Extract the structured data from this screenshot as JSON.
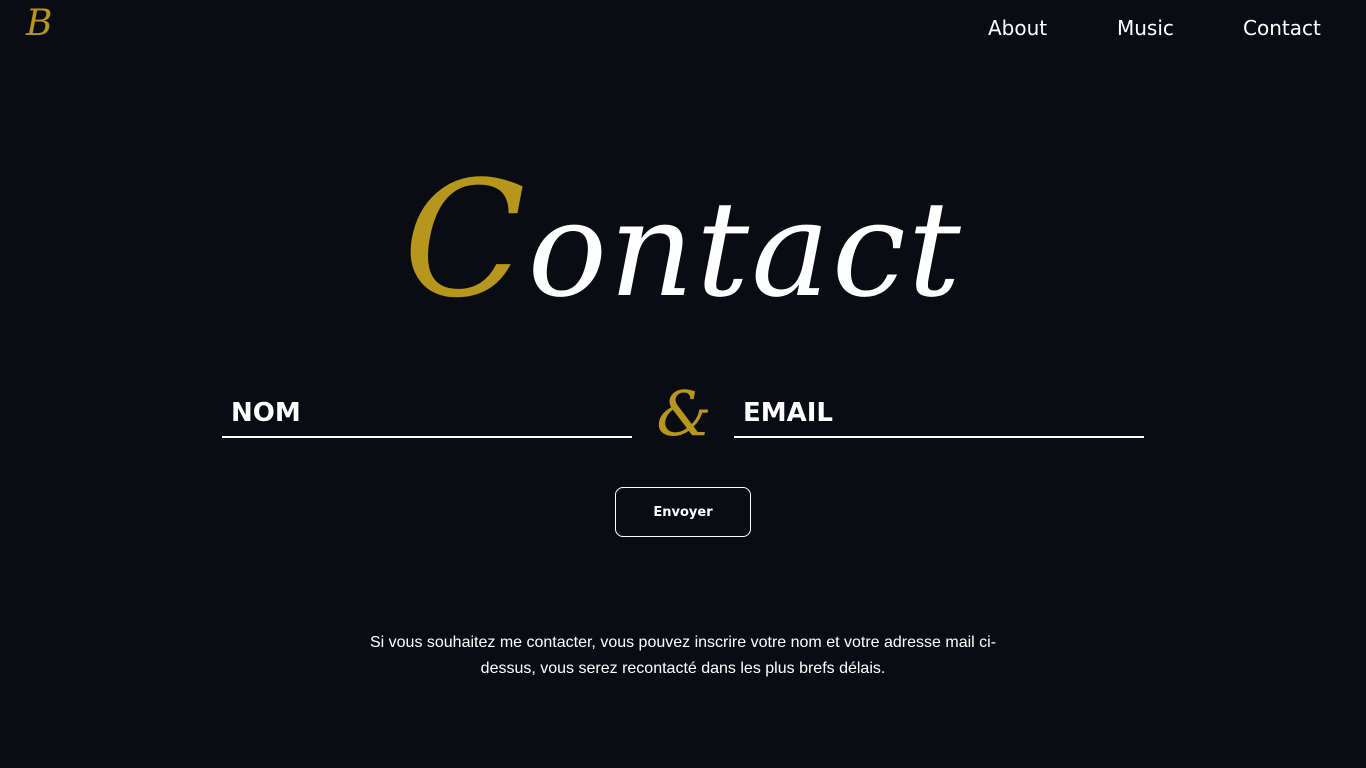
{
  "header": {
    "logo": "B",
    "nav": {
      "about": "About",
      "music": "Music",
      "contact": "Contact"
    }
  },
  "hero": {
    "title_first_letter": "C",
    "title_rest": "ontact"
  },
  "form": {
    "name_placeholder": "NOM",
    "separator": "&",
    "email_placeholder": "EMAIL",
    "submit_label": "Envoyer"
  },
  "info_text": "Si vous souhaitez me contacter, vous pouvez inscrire votre nom et votre adresse mail ci-dessus, vous serez recontacté dans les plus brefs délais.",
  "colors": {
    "background": "#0a0c13",
    "accent": "#b6961c",
    "text": "#ffffff"
  }
}
